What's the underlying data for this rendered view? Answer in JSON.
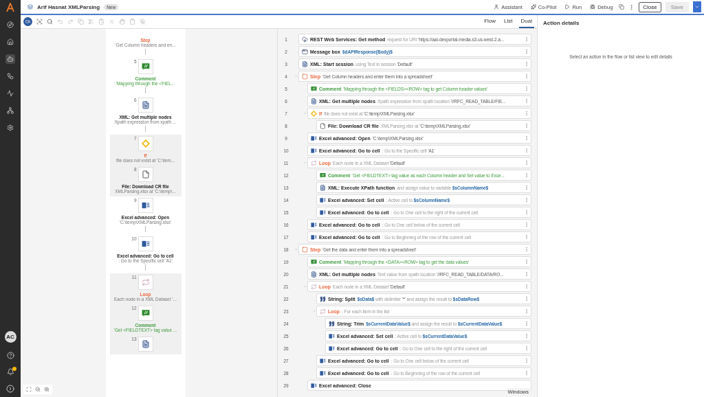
{
  "header": {
    "title": "Arif Hasnat XMLParsing",
    "badge": "New",
    "actions": [
      {
        "kind": "assistant",
        "label": "Assistant"
      },
      {
        "kind": "copilot",
        "label": "Co-Pilot"
      },
      {
        "kind": "run",
        "label": "Run"
      },
      {
        "kind": "debug",
        "label": "Debug"
      }
    ],
    "close": "Close",
    "save": {
      "label": "Save",
      "disabled": true
    }
  },
  "view_tabs": [
    {
      "label": "Flow",
      "selected": false
    },
    {
      "label": "List",
      "selected": false
    },
    {
      "label": "Dual",
      "selected": true
    }
  ],
  "details": {
    "title": "Action details",
    "hint": "Select an action in the flow or list view to edit details"
  },
  "flow_nodes": [
    {
      "kind": "step",
      "title": "Step",
      "detail": "'Get Column headers and en...",
      "in_block": false
    },
    {
      "number": "5",
      "kind": "comment",
      "title": "Comment",
      "detail": "'Mapping through the <FIEL...",
      "in_block": false
    },
    {
      "number": "6",
      "kind": "xml",
      "title": "XML: Get multiple nodes",
      "detail": "Xpath expression from xpath ...",
      "in_block": false
    },
    {
      "number": "7",
      "kind": "if",
      "title": "If",
      "detail": "file does not exist at 'C:\\tem...",
      "in_block": true
    },
    {
      "number": "8",
      "kind": "file",
      "title": "File: Download CR file",
      "detail": "XMLParsing.xlsx at 'C:\\temp\\...",
      "in_block": true
    },
    {
      "number": "9",
      "kind": "excel",
      "title": "Excel advanced: Open",
      "detail": "'C:\\temp\\XMLParsing.xlsx'",
      "in_block": false
    },
    {
      "number": "10",
      "kind": "excel",
      "title": "Excel advanced: Go to cell",
      "detail": ": Go to the Specific cell 'A1'",
      "in_block": false
    },
    {
      "number": "11",
      "kind": "loop",
      "title": "Loop",
      "detail": "Each node in a XML Dataset '...",
      "in_block": true
    },
    {
      "number": "12",
      "kind": "comment",
      "title": "Comment",
      "detail": "'Get <FIELDTEXT> tag value ...",
      "in_block": true
    },
    {
      "number": "13",
      "kind": "xml",
      "in_block": true
    }
  ],
  "rows": [
    {
      "number": "1",
      "kind": "rest",
      "title": "REST Web Services: Get method",
      "detail": [
        {
          "kind": "muted",
          "text": "request for URI "
        },
        {
          "kind": "value",
          "text": "'https://aai-devportal-media.s3.us-west-2.a..."
        }
      ]
    },
    {
      "number": "2",
      "kind": "message",
      "title": "Message box",
      "detail": [
        {
          "kind": "var",
          "text": "$dAPIResponse(Body)$"
        }
      ]
    },
    {
      "number": "3",
      "kind": "xml",
      "title": "XML: Start session",
      "detail": [
        {
          "kind": "muted",
          "text": "using Text in session "
        },
        {
          "kind": "value",
          "text": "'Default'"
        }
      ]
    },
    {
      "number": "4",
      "kind": "step",
      "title": "Step",
      "expanded": true,
      "detail": [
        {
          "kind": "value",
          "text": "'Get Column headers and enter them into a spreadsheet'"
        }
      ],
      "children": [
        {
          "number": "5",
          "kind": "comment",
          "title": "Comment",
          "detail": [
            {
              "kind": "value",
              "text": "'Mapping through the <FIELDS><ROW> tag to get Column header values'"
            }
          ]
        },
        {
          "number": "6",
          "kind": "xml",
          "title": "XML: Get multiple nodes",
          "detail": [
            {
              "kind": "muted",
              "text": "Xpath expression from xpath location "
            },
            {
              "kind": "value",
              "text": "'//RFC_READ_TABLE/FIE..."
            }
          ]
        },
        {
          "number": "7",
          "kind": "if",
          "title": "If",
          "expanded": true,
          "detail": [
            {
              "kind": "muted",
              "text": "file does not exist at "
            },
            {
              "kind": "value",
              "text": "'C:\\temp\\XMLParsing.xlsx'"
            }
          ],
          "children": [
            {
              "number": "8",
              "kind": "file",
              "title": "File: Download CR file",
              "detail": [
                {
                  "kind": "muted",
                  "text": "XMLParsing.xlsx at "
                },
                {
                  "kind": "value",
                  "text": "'C:\\temp\\XMLParsing.xlsx'"
                }
              ]
            }
          ]
        },
        {
          "number": "9",
          "kind": "excel",
          "title": "Excel advanced: Open",
          "detail": [
            {
              "kind": "value",
              "text": "'C:\\temp\\XMLParsing.xlsx'"
            }
          ]
        },
        {
          "number": "10",
          "kind": "excel",
          "title": "Excel advanced: Go to cell",
          "detail": [
            {
              "kind": "muted",
              "text": ": Go to the Specific cell "
            },
            {
              "kind": "value",
              "text": "'A1'"
            }
          ]
        },
        {
          "number": "11",
          "kind": "loop",
          "title": "Loop",
          "expanded": true,
          "detail": [
            {
              "kind": "muted",
              "text": "Each node in a XML Dataset "
            },
            {
              "kind": "value",
              "text": "'Default'"
            }
          ],
          "children": [
            {
              "number": "12",
              "kind": "comment",
              "title": "Comment",
              "detail": [
                {
                  "kind": "value",
                  "text": "'Get <FIELDTEXT> tag value as each Column header and Set value to Exce..."
                }
              ]
            },
            {
              "number": "13",
              "kind": "xml",
              "title": "XML: Execute XPath function",
              "detail": [
                {
                  "kind": "muted",
                  "text": "and assign value to variable "
                },
                {
                  "kind": "var",
                  "text": "$sColumnName$"
                }
              ]
            },
            {
              "number": "14",
              "kind": "excel",
              "title": "Excel advanced: Set cell",
              "detail": [
                {
                  "kind": "muted",
                  "text": ": Active cell to "
                },
                {
                  "kind": "var",
                  "text": "$sColumnName$"
                }
              ]
            },
            {
              "number": "15",
              "kind": "excel",
              "title": "Excel advanced: Go to cell",
              "detail": [
                {
                  "kind": "muted",
                  "text": ": Go to One cell to the right of the current cell"
                }
              ]
            }
          ]
        },
        {
          "number": "16",
          "kind": "excel",
          "title": "Excel advanced: Go to cell",
          "detail": [
            {
              "kind": "muted",
              "text": ": Go to One cell below of the current cell"
            }
          ]
        },
        {
          "number": "17",
          "kind": "excel",
          "title": "Excel advanced: Go to cell",
          "detail": [
            {
              "kind": "muted",
              "text": ": Go to Beginning of the row of the current cell"
            }
          ]
        }
      ]
    },
    {
      "number": "18",
      "kind": "step",
      "title": "Step",
      "expanded": true,
      "detail": [
        {
          "kind": "value",
          "text": "'Get the data and enter them into a spreadsheet'"
        }
      ],
      "children": [
        {
          "number": "19",
          "kind": "comment",
          "title": "Comment",
          "detail": [
            {
              "kind": "value",
              "text": "'Mapping through the <DATA><ROW> tag to get the data values'"
            }
          ]
        },
        {
          "number": "20",
          "kind": "xml",
          "title": "XML: Get multiple nodes",
          "detail": [
            {
              "kind": "muted",
              "text": "Text value from xpath location "
            },
            {
              "kind": "value",
              "text": "'//RFC_READ_TABLE/DATA/RO..."
            }
          ]
        },
        {
          "number": "21",
          "kind": "loop",
          "title": "Loop",
          "expanded": true,
          "detail": [
            {
              "kind": "muted",
              "text": "Each node in a XML Dataset "
            },
            {
              "kind": "value",
              "text": "'Default'"
            }
          ],
          "children": [
            {
              "number": "22",
              "kind": "string",
              "title": "String: Split",
              "detail": [
                {
                  "kind": "var",
                  "text": "$sData$"
                },
                {
                  "kind": "muted",
                  "text": " with delimiter "
                },
                {
                  "kind": "value",
                  "text": "'*'"
                },
                {
                  "kind": "muted",
                  "text": " and assign the result to "
                },
                {
                  "kind": "var",
                  "text": "$sDataRow$"
                }
              ]
            },
            {
              "number": "23",
              "kind": "loop",
              "title": "Loop",
              "expanded": true,
              "detail": [
                {
                  "kind": "muted",
                  "text": ": For each item in the list"
                }
              ],
              "children": [
                {
                  "number": "24",
                  "kind": "string",
                  "title": "String: Trim",
                  "detail": [
                    {
                      "kind": "var",
                      "text": "$sCurrentDataValue$"
                    },
                    {
                      "kind": "muted",
                      "text": " and assign the result to "
                    },
                    {
                      "kind": "var",
                      "text": "$sCurrentDataValue$"
                    }
                  ]
                },
                {
                  "number": "25",
                  "kind": "excel",
                  "title": "Excel advanced: Set cell",
                  "detail": [
                    {
                      "kind": "muted",
                      "text": ": Active cell to "
                    },
                    {
                      "kind": "var",
                      "text": "$sCurrentDataValue$"
                    }
                  ]
                },
                {
                  "number": "26",
                  "kind": "excel",
                  "title": "Excel advanced: Go to cell",
                  "detail": [
                    {
                      "kind": "muted",
                      "text": ": Go to One cell to the right of the current cell"
                    }
                  ]
                }
              ]
            },
            {
              "number": "27",
              "kind": "excel",
              "title": "Excel advanced: Go to cell",
              "detail": [
                {
                  "kind": "muted",
                  "text": ": Go to One cell below of the current cell"
                }
              ]
            },
            {
              "number": "28",
              "kind": "excel",
              "title": "Excel advanced: Go to cell",
              "detail": [
                {
                  "kind": "muted",
                  "text": ": Go to Beginning of the row of the current cell"
                }
              ]
            }
          ]
        },
        {
          "number": "29",
          "kind": "excel",
          "title": "Excel advanced: Close",
          "has_menu": false
        }
      ]
    }
  ],
  "list_footer": "Windows",
  "nav_avatar": "AC"
}
